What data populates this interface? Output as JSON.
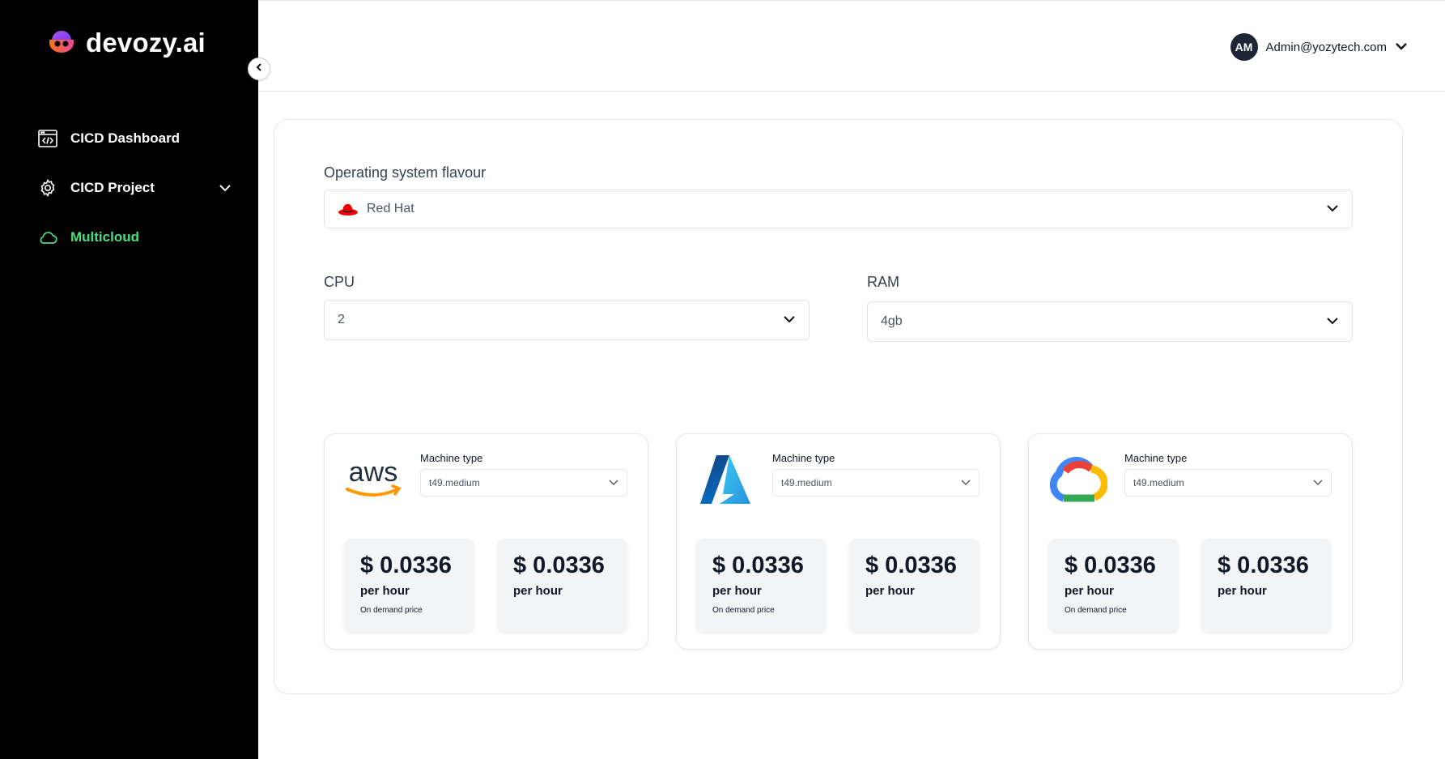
{
  "brand": {
    "name": "devozy.ai"
  },
  "sidebar": {
    "items": [
      {
        "label": "CICD Dashboard",
        "icon": "code-window-icon"
      },
      {
        "label": "CICD Project",
        "icon": "gear-icon"
      },
      {
        "label": "Multicloud",
        "icon": "cloud-icon",
        "active": true
      }
    ]
  },
  "header": {
    "user": {
      "initials": "AM",
      "email": "Admin@yozytech.com"
    }
  },
  "form": {
    "os": {
      "label": "Operating system flavour",
      "value": "Red Hat"
    },
    "cpu": {
      "label": "CPU",
      "value": "2"
    },
    "ram": {
      "label": "RAM",
      "value": "4gb"
    }
  },
  "providers": [
    {
      "name": "aws",
      "logo": "aws-logo",
      "machine_type_label": "Machine type",
      "machine_type": "t49.medium",
      "prices": [
        {
          "amount": "$ 0.0336",
          "unit": "per hour",
          "note": "On demand price"
        },
        {
          "amount": "$ 0.0336",
          "unit": "per hour"
        }
      ]
    },
    {
      "name": "azure",
      "logo": "azure-logo",
      "machine_type_label": "Machine type",
      "machine_type": "t49.medium",
      "prices": [
        {
          "amount": "$ 0.0336",
          "unit": "per hour",
          "note": "On demand price"
        },
        {
          "amount": "$ 0.0336",
          "unit": "per hour"
        }
      ]
    },
    {
      "name": "gcp",
      "logo": "google-cloud-logo",
      "machine_type_label": "Machine type",
      "machine_type": "t49.medium",
      "prices": [
        {
          "amount": "$ 0.0336",
          "unit": "per hour",
          "note": "On demand price"
        },
        {
          "amount": "$ 0.0336",
          "unit": "per hour"
        }
      ]
    }
  ],
  "colors": {
    "accent_active": "#4ade80",
    "sidebar_bg": "#000000",
    "redhat": "#ee0000"
  }
}
